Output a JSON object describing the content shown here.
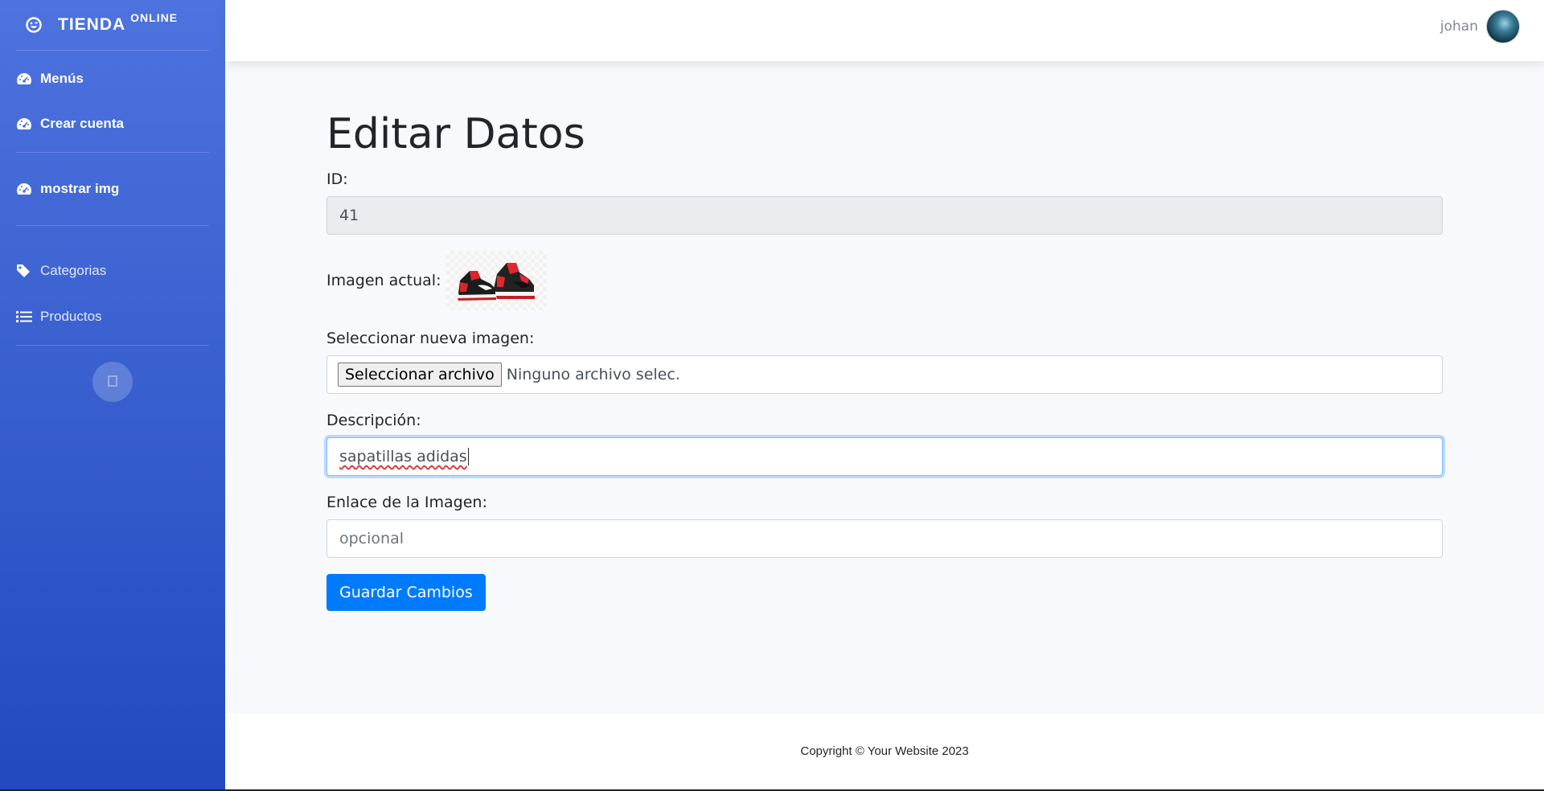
{
  "brand": {
    "title": "TIENDA",
    "sup": "ONLINE",
    "icon": "laugh-wink-icon"
  },
  "sidebar": {
    "items": [
      {
        "label": "Menús",
        "icon": "dashboard-icon"
      },
      {
        "label": "Crear cuenta",
        "icon": "dashboard-icon"
      },
      {
        "label": "mostrar img",
        "icon": "dashboard-icon"
      },
      {
        "label": "Categorias",
        "icon": "tag-icon"
      },
      {
        "label": "Productos",
        "icon": "list-icon"
      }
    ],
    "toggle_icon": "chevron-left-icon"
  },
  "topbar": {
    "user_name": "johan"
  },
  "form": {
    "title": "Editar Datos",
    "id_label": "ID:",
    "id_value": "41",
    "current_image_label": "Imagen actual:",
    "new_image_label": "Seleccionar nueva imagen:",
    "file_button": "Seleccionar archivo",
    "file_status": "Ninguno archivo selec.",
    "description_label": "Descripción:",
    "description_value": "sapatillas adidas",
    "link_label": "Enlace de la Imagen:",
    "link_placeholder": "opcional",
    "submit_label": "Guardar Cambios"
  },
  "footer": {
    "copyright": "Copyright © Your Website 2023"
  },
  "colors": {
    "sidebar_top": "#4e73df",
    "sidebar_bottom": "#224abe",
    "primary": "#007bff"
  }
}
